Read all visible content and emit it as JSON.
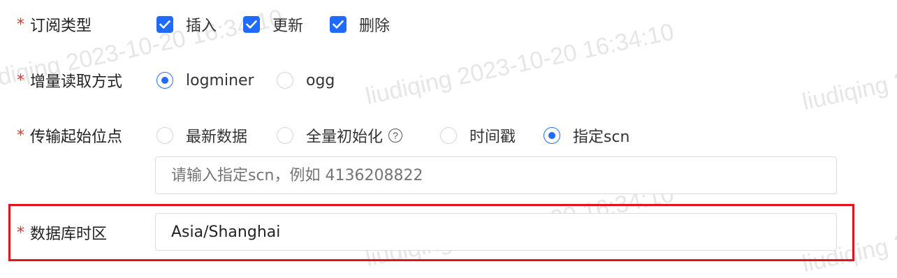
{
  "watermark": {
    "text": "liudiqing 2023-10-20 16:34:10"
  },
  "subscription_type": {
    "label": "订阅类型",
    "options": [
      {
        "label": "插入",
        "checked": true
      },
      {
        "label": "更新",
        "checked": true
      },
      {
        "label": "删除",
        "checked": true
      }
    ]
  },
  "incremental_read": {
    "label": "增量读取方式",
    "options": [
      {
        "label": "logminer",
        "selected": true
      },
      {
        "label": "ogg",
        "selected": false
      }
    ]
  },
  "transfer_start": {
    "label": "传输起始位点",
    "options": [
      {
        "label": "最新数据",
        "selected": false
      },
      {
        "label": "全量初始化",
        "selected": false
      },
      {
        "label": "时间戳",
        "selected": false
      },
      {
        "label": "指定scn",
        "selected": true
      }
    ],
    "help_icon": "?",
    "scn_placeholder": "请输入指定scn，例如 4136208822"
  },
  "db_timezone": {
    "label": "数据库时区",
    "value": "Asia/Shanghai"
  },
  "colors": {
    "accent": "#1f6bff",
    "required": "#e5322d",
    "highlight": "#e0141c"
  }
}
